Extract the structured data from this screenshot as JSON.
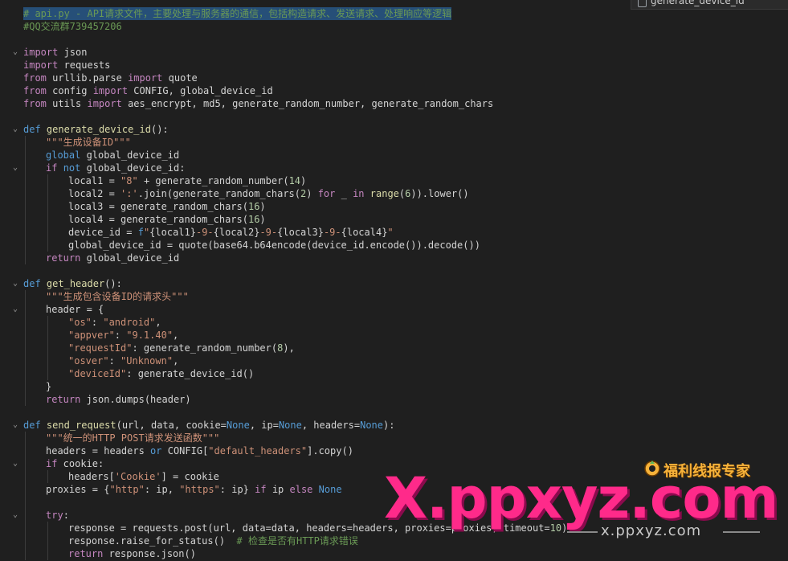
{
  "tab": {
    "label": "generate_device_id"
  },
  "lines": [
    {
      "fold": false,
      "indent": 0,
      "tokens": [
        [
          "cmt",
          "# api.py - API请求文件，主要处理与服务器的通信，包括构造请求、发送请求、处理响应等逻辑"
        ]
      ]
    },
    {
      "fold": false,
      "indent": 0,
      "tokens": [
        [
          "cmt",
          "#QQ交流群739457206"
        ]
      ]
    },
    {
      "fold": false,
      "indent": 0,
      "tokens": []
    },
    {
      "fold": true,
      "indent": 0,
      "tokens": [
        [
          "kw2",
          "import"
        ],
        [
          "p",
          " json"
        ]
      ]
    },
    {
      "fold": false,
      "indent": 0,
      "tokens": [
        [
          "kw2",
          "import"
        ],
        [
          "p",
          " requests"
        ]
      ]
    },
    {
      "fold": false,
      "indent": 0,
      "tokens": [
        [
          "kw2",
          "from"
        ],
        [
          "p",
          " urllib.parse "
        ],
        [
          "kw2",
          "import"
        ],
        [
          "p",
          " quote"
        ]
      ]
    },
    {
      "fold": false,
      "indent": 0,
      "tokens": [
        [
          "kw2",
          "from"
        ],
        [
          "p",
          " config "
        ],
        [
          "kw2",
          "import"
        ],
        [
          "p",
          " CONFIG, global_device_id"
        ]
      ]
    },
    {
      "fold": false,
      "indent": 0,
      "tokens": [
        [
          "kw2",
          "from"
        ],
        [
          "p",
          " utils "
        ],
        [
          "kw2",
          "import"
        ],
        [
          "p",
          " aes_encrypt, md5, generate_random_number, generate_random_chars"
        ]
      ]
    },
    {
      "fold": false,
      "indent": 0,
      "tokens": []
    },
    {
      "fold": true,
      "indent": 0,
      "tokens": [
        [
          "kw",
          "def"
        ],
        [
          "p",
          " "
        ],
        [
          "fn",
          "generate_device_id"
        ],
        [
          "p",
          "():"
        ]
      ]
    },
    {
      "fold": false,
      "indent": 1,
      "tokens": [
        [
          "str",
          "\"\"\"生成设备ID\"\"\""
        ]
      ]
    },
    {
      "fold": false,
      "indent": 1,
      "tokens": [
        [
          "kw",
          "global"
        ],
        [
          "p",
          " global_device_id"
        ]
      ]
    },
    {
      "fold": true,
      "indent": 1,
      "tokens": [
        [
          "kw2",
          "if"
        ],
        [
          "p",
          " "
        ],
        [
          "kw",
          "not"
        ],
        [
          "p",
          " global_device_id:"
        ]
      ]
    },
    {
      "fold": false,
      "indent": 2,
      "tokens": [
        [
          "p",
          "local1 = "
        ],
        [
          "str",
          "\"8\""
        ],
        [
          "p",
          " + generate_random_number("
        ],
        [
          "num",
          "14"
        ],
        [
          "p",
          ")"
        ]
      ]
    },
    {
      "fold": false,
      "indent": 2,
      "tokens": [
        [
          "p",
          "local2 = "
        ],
        [
          "str",
          "':'"
        ],
        [
          "p",
          ".join(generate_random_chars("
        ],
        [
          "num",
          "2"
        ],
        [
          "p",
          ") "
        ],
        [
          "kw2",
          "for"
        ],
        [
          "p",
          " _ "
        ],
        [
          "kw2",
          "in"
        ],
        [
          "p",
          " "
        ],
        [
          "fn",
          "range"
        ],
        [
          "p",
          "("
        ],
        [
          "num",
          "6"
        ],
        [
          "p",
          ")).lower()"
        ]
      ]
    },
    {
      "fold": false,
      "indent": 2,
      "tokens": [
        [
          "p",
          "local3 = generate_random_chars("
        ],
        [
          "num",
          "16"
        ],
        [
          "p",
          ")"
        ]
      ]
    },
    {
      "fold": false,
      "indent": 2,
      "tokens": [
        [
          "p",
          "local4 = generate_random_chars("
        ],
        [
          "num",
          "16"
        ],
        [
          "p",
          ")"
        ]
      ]
    },
    {
      "fold": false,
      "indent": 2,
      "tokens": [
        [
          "p",
          "device_id = "
        ],
        [
          "kw",
          "f"
        ],
        [
          "str",
          "\""
        ],
        [
          "p",
          "{local1}"
        ],
        [
          "str",
          "-9-"
        ],
        [
          "p",
          "{local2}"
        ],
        [
          "str",
          "-9-"
        ],
        [
          "p",
          "{local3}"
        ],
        [
          "str",
          "-9-"
        ],
        [
          "p",
          "{local4}"
        ],
        [
          "str",
          "\""
        ]
      ]
    },
    {
      "fold": false,
      "indent": 2,
      "tokens": [
        [
          "p",
          "global_device_id = quote(base64.b64encode(device_id.encode()).decode())"
        ]
      ]
    },
    {
      "fold": false,
      "indent": 1,
      "tokens": [
        [
          "kw2",
          "return"
        ],
        [
          "p",
          " global_device_id"
        ]
      ]
    },
    {
      "fold": false,
      "indent": 0,
      "tokens": []
    },
    {
      "fold": true,
      "indent": 0,
      "tokens": [
        [
          "kw",
          "def"
        ],
        [
          "p",
          " "
        ],
        [
          "fn",
          "get_header"
        ],
        [
          "p",
          "():"
        ]
      ]
    },
    {
      "fold": false,
      "indent": 1,
      "tokens": [
        [
          "str",
          "\"\"\"生成包含设备ID的请求头\"\"\""
        ]
      ]
    },
    {
      "fold": true,
      "indent": 1,
      "tokens": [
        [
          "p",
          "header = {"
        ]
      ]
    },
    {
      "fold": false,
      "indent": 2,
      "tokens": [
        [
          "str",
          "\"os\""
        ],
        [
          "p",
          ": "
        ],
        [
          "str",
          "\"android\""
        ],
        [
          "p",
          ","
        ]
      ]
    },
    {
      "fold": false,
      "indent": 2,
      "tokens": [
        [
          "str",
          "\"appver\""
        ],
        [
          "p",
          ": "
        ],
        [
          "str",
          "\"9.1.40\""
        ],
        [
          "p",
          ","
        ]
      ]
    },
    {
      "fold": false,
      "indent": 2,
      "tokens": [
        [
          "str",
          "\"requestId\""
        ],
        [
          "p",
          ": generate_random_number("
        ],
        [
          "num",
          "8"
        ],
        [
          "p",
          "),"
        ]
      ]
    },
    {
      "fold": false,
      "indent": 2,
      "tokens": [
        [
          "str",
          "\"osver\""
        ],
        [
          "p",
          ": "
        ],
        [
          "str",
          "\"Unknown\""
        ],
        [
          "p",
          ","
        ]
      ]
    },
    {
      "fold": false,
      "indent": 2,
      "tokens": [
        [
          "str",
          "\"deviceId\""
        ],
        [
          "p",
          ": generate_device_id()"
        ]
      ]
    },
    {
      "fold": false,
      "indent": 1,
      "tokens": [
        [
          "p",
          "}"
        ]
      ]
    },
    {
      "fold": false,
      "indent": 1,
      "tokens": [
        [
          "kw2",
          "return"
        ],
        [
          "p",
          " json.dumps(header)"
        ]
      ]
    },
    {
      "fold": false,
      "indent": 0,
      "tokens": []
    },
    {
      "fold": true,
      "indent": 0,
      "tokens": [
        [
          "kw",
          "def"
        ],
        [
          "p",
          " "
        ],
        [
          "fn",
          "send_request"
        ],
        [
          "p",
          "(url, data, cookie="
        ],
        [
          "kw",
          "None"
        ],
        [
          "p",
          ", ip="
        ],
        [
          "kw",
          "None"
        ],
        [
          "p",
          ", headers="
        ],
        [
          "kw",
          "None"
        ],
        [
          "p",
          "):"
        ]
      ]
    },
    {
      "fold": false,
      "indent": 1,
      "tokens": [
        [
          "str",
          "\"\"\"统一的HTTP POST请求发送函数\"\"\""
        ]
      ]
    },
    {
      "fold": false,
      "indent": 1,
      "tokens": [
        [
          "p",
          "headers = headers "
        ],
        [
          "kw",
          "or"
        ],
        [
          "p",
          " CONFIG["
        ],
        [
          "str",
          "\"default_headers\""
        ],
        [
          "p",
          "].copy()"
        ]
      ]
    },
    {
      "fold": true,
      "indent": 1,
      "tokens": [
        [
          "kw2",
          "if"
        ],
        [
          "p",
          " cookie:"
        ]
      ]
    },
    {
      "fold": false,
      "indent": 2,
      "tokens": [
        [
          "p",
          "headers["
        ],
        [
          "str",
          "'Cookie'"
        ],
        [
          "p",
          "] = cookie"
        ]
      ]
    },
    {
      "fold": false,
      "indent": 1,
      "tokens": [
        [
          "p",
          "proxies = {"
        ],
        [
          "str",
          "\"http\""
        ],
        [
          "p",
          ": ip, "
        ],
        [
          "str",
          "\"https\""
        ],
        [
          "p",
          ": ip} "
        ],
        [
          "kw2",
          "if"
        ],
        [
          "p",
          " ip "
        ],
        [
          "kw2",
          "else"
        ],
        [
          "p",
          " "
        ],
        [
          "kw",
          "None"
        ]
      ]
    },
    {
      "fold": false,
      "indent": 0,
      "tokens": []
    },
    {
      "fold": true,
      "indent": 1,
      "tokens": [
        [
          "kw2",
          "try"
        ],
        [
          "p",
          ":"
        ]
      ]
    },
    {
      "fold": false,
      "indent": 2,
      "tokens": [
        [
          "p",
          "response = requests.post(url, data=data, headers=headers, proxies=proxies, timeout="
        ],
        [
          "num",
          "10"
        ],
        [
          "p",
          ")"
        ]
      ]
    },
    {
      "fold": false,
      "indent": 2,
      "tokens": [
        [
          "p",
          "response.raise_for_status()  "
        ],
        [
          "cmt",
          "# 检查是否有HTTP请求错误"
        ]
      ]
    },
    {
      "fold": false,
      "indent": 2,
      "tokens": [
        [
          "kw2",
          "return"
        ],
        [
          "p",
          " response.json()"
        ]
      ]
    }
  ],
  "watermark": {
    "big": "X.ppxyz.com",
    "small": "x.ppxyz.com",
    "brand": "福利线报专家"
  }
}
